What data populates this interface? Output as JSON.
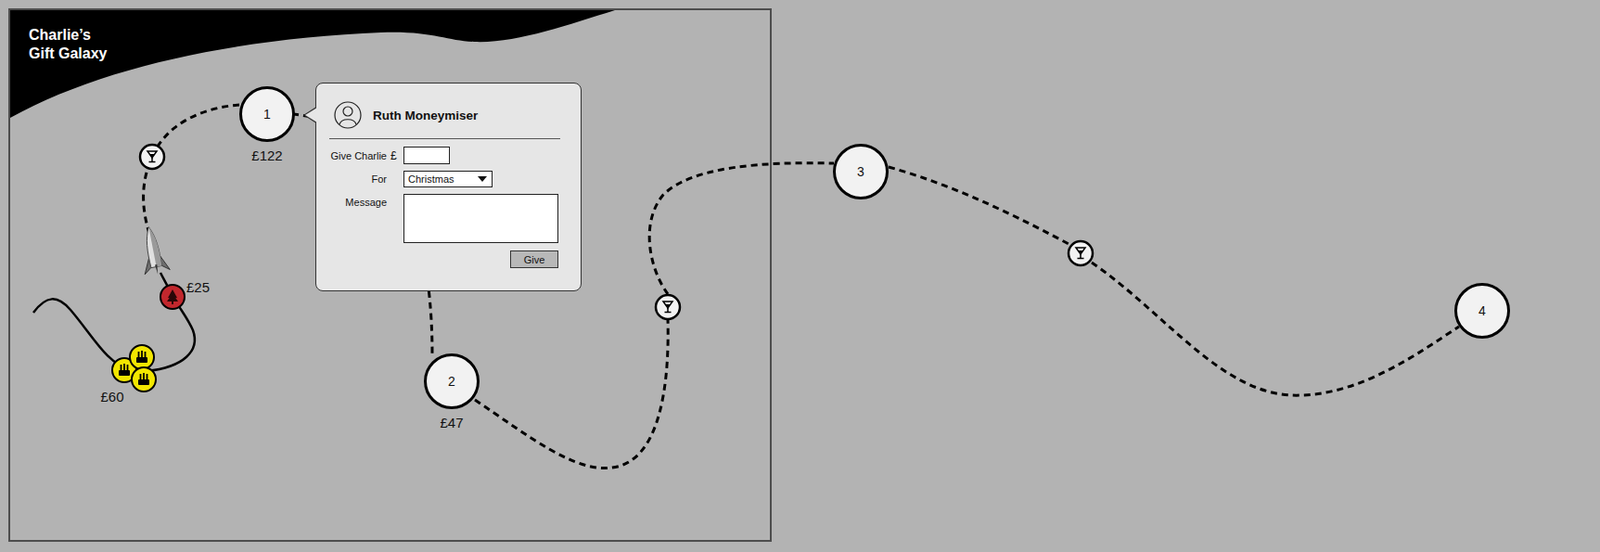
{
  "app": {
    "title_lines": [
      "Charlie’s",
      "Gift Galaxy"
    ]
  },
  "planets": [
    {
      "label": "1",
      "amount": "£122"
    },
    {
      "label": "2",
      "amount": "£47"
    },
    {
      "label": "3"
    },
    {
      "label": "4"
    }
  ],
  "gifts": [
    {
      "kind": "tree",
      "amount": "£25",
      "color": "#c1272d"
    },
    {
      "kind": "cluster",
      "amount": "£60",
      "color": "#f2e600"
    }
  ],
  "popup": {
    "name": "Ruth Moneymiser",
    "fields": [
      {
        "label": "Give Charlie",
        "prefix": "£",
        "kind": "input",
        "value": ""
      },
      {
        "label": "For",
        "kind": "select",
        "value": "Christmas"
      },
      {
        "label": "Message",
        "kind": "textarea",
        "value": ""
      }
    ],
    "button": "Give"
  }
}
